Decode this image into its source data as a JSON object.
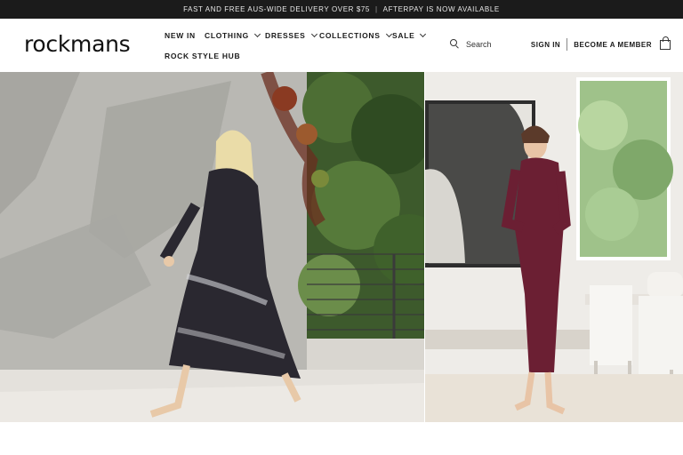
{
  "announcement": {
    "left": "FAST AND FREE AUS-WIDE DELIVERY OVER $75",
    "separator": "|",
    "right": "AFTERPAY IS NOW AVAILABLE"
  },
  "brand": {
    "logo": "rockmans"
  },
  "nav": {
    "items": [
      {
        "label": "NEW IN",
        "has_dropdown": false
      },
      {
        "label": "CLOTHING",
        "has_dropdown": true
      },
      {
        "label": "DRESSES",
        "has_dropdown": true
      },
      {
        "label": "COLLECTIONS",
        "has_dropdown": true
      },
      {
        "label": "SALE",
        "has_dropdown": true
      },
      {
        "label": "ROCK STYLE HUB",
        "has_dropdown": false
      }
    ]
  },
  "search": {
    "placeholder": "Search"
  },
  "account": {
    "sign_in": "SIGN IN",
    "become_member": "BECOME A MEMBER"
  },
  "colors": {
    "announcement_bg": "#1b1b1b",
    "announcement_text": "#e8e8e8",
    "header_bg": "#ffffff",
    "text": "#1a1a1a"
  },
  "icons": [
    "search-icon",
    "chevron-down-icon",
    "shopping-bag-icon"
  ]
}
